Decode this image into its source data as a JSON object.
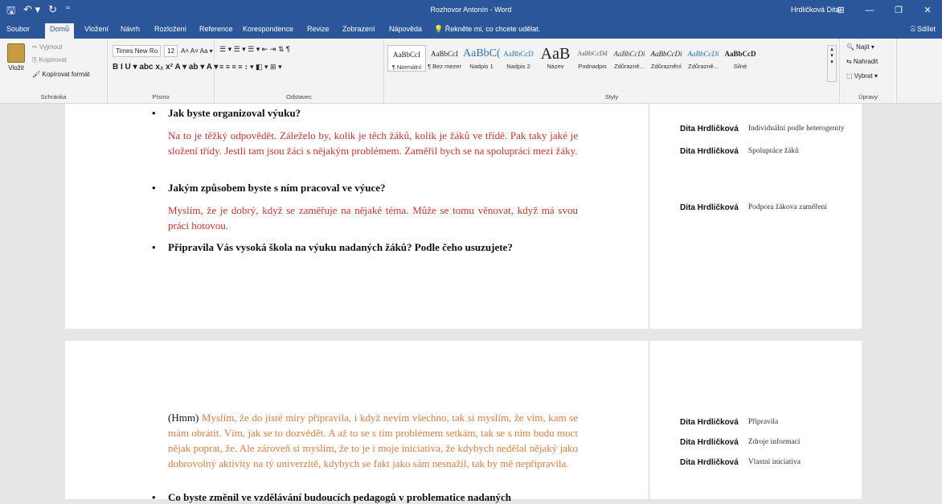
{
  "titlebar": {
    "qat": [
      "🖫",
      "↶ ▾",
      "↻",
      "⁼"
    ],
    "doc_title": "Rozhovor Antonín  -  Word",
    "user": "Hrdličková Dita",
    "win_buttons": [
      "⊞",
      "—",
      "❐",
      "✕"
    ]
  },
  "tabs": [
    "Soubor",
    "Domů",
    "Vložení",
    "Návrh",
    "Rozložení",
    "Reference",
    "Korespondence",
    "Revize",
    "Zobrazení",
    "Nápověda",
    "💡 Řekněte mi, co chcete udělat."
  ],
  "active_tab": "Domů",
  "share_label": "⍓ Sdílet",
  "ribbon": {
    "clipboard": {
      "paste": "Vložit",
      "cut": "✂ Vyjmout",
      "copy": "⎘ Kopírovat",
      "format_painter": "🖌 Kopírovat formát",
      "label": "Schránka"
    },
    "font": {
      "font_name": "Times New Ro",
      "font_size": "12",
      "row1_tools": "A˄  A˅  Aa ▾",
      "row2_tools": "B  I  U ▾  abc  x₂  x²  A ▾  ab ▾  A ▾",
      "label": "Písmo"
    },
    "paragraph": {
      "row1_tools": "☰ ▾  ☰ ▾  ☰ ▾  ⇤  ⇥  ⇅  ¶",
      "row2_tools": "≡  ≡  ≡  ≡   ↕ ▾   ◧ ▾   ⊞ ▾",
      "label": "Odstavec"
    },
    "styles": {
      "items": [
        {
          "preview": "AaBbCcI",
          "name": "¶ Normální"
        },
        {
          "preview": "AaBbCcI",
          "name": "¶ Bez mezer"
        },
        {
          "preview": "AaBbC(",
          "name": "Nadpis 1"
        },
        {
          "preview": "AaBbCcD",
          "name": "Nadpis 2"
        },
        {
          "preview": "AaB",
          "name": "Název"
        },
        {
          "preview": "AaBbCcDd",
          "name": "Podnadpis"
        },
        {
          "preview": "AaBbCcDi",
          "name": "Zdůrazně..."
        },
        {
          "preview": "AaBbCcDi",
          "name": "Zdůraznění"
        },
        {
          "preview": "AaBbCcDi",
          "name": "Zdůrazně..."
        },
        {
          "preview": "AaBbCcD",
          "name": "Silné"
        }
      ],
      "label": "Styly"
    },
    "editing": {
      "find": "🔍 Najít ▾",
      "replace": "⇆ Nahradit",
      "select": "⬚ Vybrat ▾",
      "label": "Úpravy"
    }
  },
  "document": {
    "page1": {
      "q1": "Jak byste organizoval výuku?",
      "a1": "Na to je těžký odpovědět. Záleželo by, kolik je těch žáků, kolik je žáků ve třídě. Pak taky jaké je složení třídy. Jestli tam jsou žáci s nějakým problémem. Zaměřil bych se na spolupráci mezi žáky.",
      "q2": "Jakým způsobem byste s ním pracoval ve výuce?",
      "a2": "Myslím, že je dobrý, když se zaměřuje na nějaké téma. Může se tomu věnovat, když má svou práci hotovou.",
      "q3": "Připravila Vás vysoká škola na výuku nadaných žáků? Podle čeho usuzujete?"
    },
    "page2": {
      "a_prefix": "(Hmm)",
      "a_body": " Myslím, že do jisté míry připravila, i když nevím všechno, tak si myslím, že vím, kam se mám obrátit. Vím, jak se to dozvědět. A až to se s tím problémem setkám, tak se s ním budu moct nějak poprat, že. Ale zároveň si myslím, že to je i moje iniciativa, že kdybych nedělal nějaký jako dobrovolný aktivity na tý univerzitě, kdybych se fakt jako sám nesnažil, tak by mě nepřipravila.",
      "q_cut": "Co byste změnil ve vzdělávání budoucích pedagogů v problematice nadaných"
    },
    "bullet": "•"
  },
  "comments": [
    {
      "author": "Dita Hrdličková",
      "text": "Individuální podle heterogenity"
    },
    {
      "author": "Dita Hrdličková",
      "text": "Spolupráce žáků"
    },
    {
      "author": "Dita Hrdličková",
      "text": "Podpora žákova zaměření"
    },
    {
      "author": "Dita Hrdličková",
      "text": "Připravila"
    },
    {
      "author": "Dita Hrdličková",
      "text": "Zdroje informací"
    },
    {
      "author": "Dita Hrdličková",
      "text": "Vlastní iniciativa"
    }
  ],
  "colors": {
    "titlebar": "#2b579a",
    "answer_red": "#d32f2f",
    "answer_orange": "#e07b3c"
  }
}
